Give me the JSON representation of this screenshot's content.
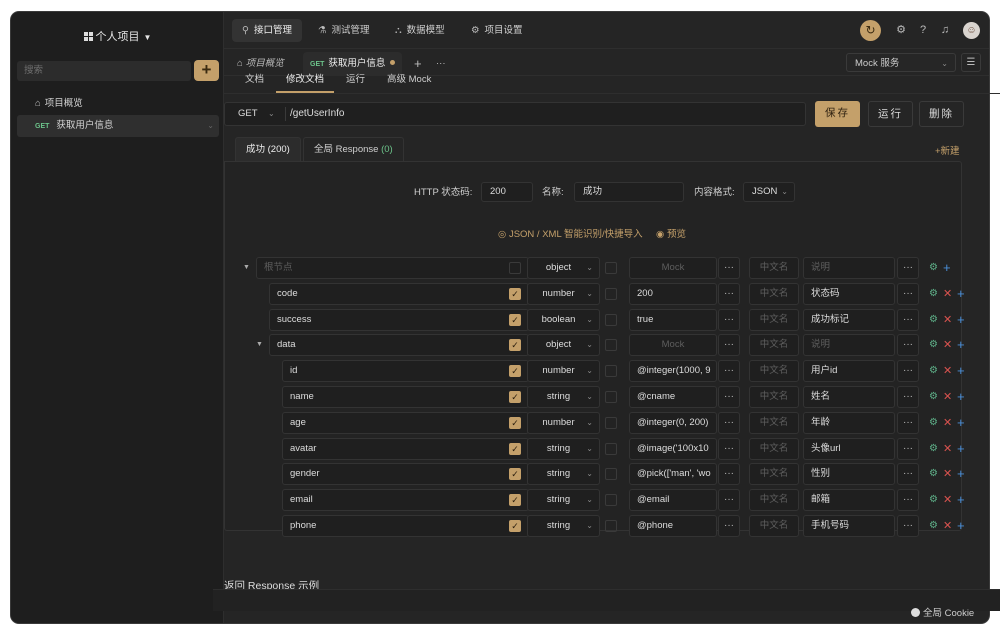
{
  "sidebar": {
    "project_title": "个人项目",
    "search_placeholder": "搜索",
    "items": [
      {
        "label": "项目概览",
        "method": ""
      },
      {
        "label": "获取用户信息",
        "method": "GET"
      }
    ]
  },
  "topnav": {
    "items": [
      "接口管理",
      "测试管理",
      "数据模型",
      "项目设置"
    ]
  },
  "tabs": {
    "items": [
      {
        "label": "项目概览",
        "method": ""
      },
      {
        "label": "获取用户信息",
        "method": "GET"
      }
    ],
    "add": "+",
    "more": "···",
    "mock_select": "Mock 服务"
  },
  "subtabs": [
    "文档",
    "修改文档",
    "运行",
    "高级 Mock"
  ],
  "request": {
    "method": "GET",
    "path": "/getUserInfo",
    "save_label": "保存",
    "run_label": "运行",
    "delete_label": "删除"
  },
  "response_tabs": [
    {
      "label": "成功 (200)"
    },
    {
      "label": "全局 Response",
      "count": "(0)"
    }
  ],
  "new_label": "+新建",
  "response_meta": {
    "status_label": "HTTP 状态码:",
    "status_value": "200",
    "name_label": "名称:",
    "name_value": "成功",
    "format_label": "内容格式:",
    "format_value": "JSON",
    "json_import": "JSON / XML 智能识别/快捷导入",
    "preview": "预览"
  },
  "schema": {
    "root": {
      "name_placeholder": "根节点",
      "type": "object",
      "mock_placeholder": "Mock",
      "cn_placeholder": "中文名",
      "desc_placeholder": "说明"
    },
    "rows": [
      {
        "name": "code",
        "type": "number",
        "mock": "200",
        "desc": "状态码",
        "level": 1
      },
      {
        "name": "success",
        "type": "boolean",
        "mock": "true",
        "desc": "成功标记",
        "level": 1
      },
      {
        "name": "data",
        "type": "object",
        "mock": "",
        "desc": "",
        "level": 1
      },
      {
        "name": "id",
        "type": "number",
        "mock": "@integer(1000, 9",
        "desc": "用户id",
        "level": 2
      },
      {
        "name": "name",
        "type": "string",
        "mock": "@cname",
        "desc": "姓名",
        "level": 2
      },
      {
        "name": "age",
        "type": "number",
        "mock": "@integer(0, 200)",
        "desc": "年龄",
        "level": 2
      },
      {
        "name": "avatar",
        "type": "string",
        "mock": "@image('100x10",
        "desc": "头像url",
        "level": 2
      },
      {
        "name": "gender",
        "type": "string",
        "mock": "@pick(['man', 'wo",
        "desc": "性别",
        "level": 2
      },
      {
        "name": "email",
        "type": "string",
        "mock": "@email",
        "desc": "邮箱",
        "level": 2
      },
      {
        "name": "phone",
        "type": "string",
        "mock": "@phone",
        "desc": "手机号码",
        "level": 2
      }
    ]
  },
  "section_title": "返回 Response 示例",
  "footer": {
    "cookie_label": "全局 Cookie"
  }
}
